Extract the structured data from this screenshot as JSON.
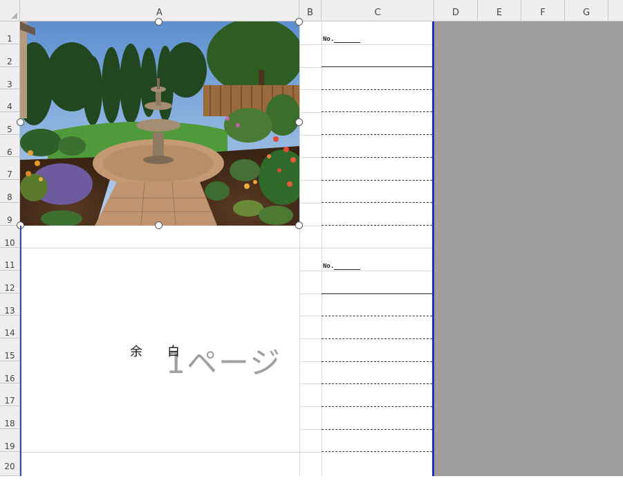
{
  "columns": [
    "A",
    "B",
    "C",
    "D",
    "E",
    "F",
    "G"
  ],
  "rows": [
    "1",
    "2",
    "3",
    "4",
    "5",
    "6",
    "7",
    "8",
    "9",
    "10",
    "11",
    "12",
    "13",
    "14",
    "15",
    "16",
    "17",
    "18",
    "19",
    "20"
  ],
  "cell_label_no": "No.",
  "blank_text": "余　　白",
  "page_watermark": "1ページ",
  "image": {
    "subject": "garden with stone fountain"
  },
  "colors": {
    "page_border": "#1f2fbf",
    "out_of_print_area": "#9e9e9e"
  }
}
